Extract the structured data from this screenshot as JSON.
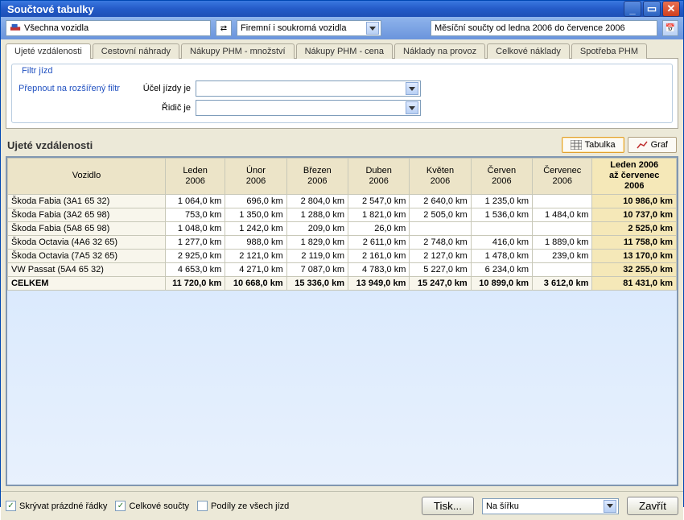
{
  "window": {
    "title": "Součtové tabulky"
  },
  "toolbar": {
    "vehicle": "Všechna vozidla",
    "ownership": "Firemní i soukromá vozidla",
    "period": "Měsíční součty od ledna 2006 do července 2006"
  },
  "tabs": [
    "Ujeté vzdálenosti",
    "Cestovní náhrady",
    "Nákupy PHM - množství",
    "Nákupy PHM - cena",
    "Náklady na provoz",
    "Celkové náklady",
    "Spotřeba PHM"
  ],
  "filter": {
    "legend": "Filtr jízd",
    "link": "Přepnout na rozšířený filtr",
    "purpose_lbl": "Účel jízdy je",
    "driver_lbl": "Řidič je"
  },
  "section": {
    "title": "Ujeté vzdálenosti",
    "tablabel": "Tabulka",
    "graflabel": "Graf"
  },
  "grid": {
    "col_vehicle": "Vozidlo",
    "months": [
      "Leden 2006",
      "Únor 2006",
      "Březen 2006",
      "Duben 2006",
      "Květen 2006",
      "Červen 2006",
      "Červenec 2006"
    ],
    "col_total": "Leden 2006 až červenec 2006",
    "rows": [
      {
        "name": "Škoda Fabia (3A1 65 32)",
        "v": [
          "1 064,0 km",
          "696,0 km",
          "2 804,0 km",
          "2 547,0 km",
          "2 640,0 km",
          "1 235,0 km",
          ""
        ],
        "t": "10 986,0 km"
      },
      {
        "name": "Škoda Fabia (3A2 65 98)",
        "v": [
          "753,0 km",
          "1 350,0 km",
          "1 288,0 km",
          "1 821,0 km",
          "2 505,0 km",
          "1 536,0 km",
          "1 484,0 km"
        ],
        "t": "10 737,0 km"
      },
      {
        "name": "Škoda Fabia (5A8 65 98)",
        "v": [
          "1 048,0 km",
          "1 242,0 km",
          "209,0 km",
          "26,0 km",
          "",
          "",
          ""
        ],
        "t": "2 525,0 km"
      },
      {
        "name": "Škoda Octavia (4A6 32 65)",
        "v": [
          "1 277,0 km",
          "988,0 km",
          "1 829,0 km",
          "2 611,0 km",
          "2 748,0 km",
          "416,0 km",
          "1 889,0 km"
        ],
        "t": "11 758,0 km"
      },
      {
        "name": "Škoda Octavia (7A5 32 65)",
        "v": [
          "2 925,0 km",
          "2 121,0 km",
          "2 119,0 km",
          "2 161,0 km",
          "2 127,0 km",
          "1 478,0 km",
          "239,0 km"
        ],
        "t": "13 170,0 km"
      },
      {
        "name": "VW Passat (5A4 65 32)",
        "v": [
          "4 653,0 km",
          "4 271,0 km",
          "7 087,0 km",
          "4 783,0 km",
          "5 227,0 km",
          "6 234,0 km",
          ""
        ],
        "t": "32 255,0 km"
      }
    ],
    "totalrow": {
      "name": "CELKEM",
      "v": [
        "11 720,0 km",
        "10 668,0 km",
        "15 336,0 km",
        "13 949,0 km",
        "15 247,0 km",
        "10 899,0 km",
        "3 612,0 km"
      ],
      "t": "81 431,0 km"
    }
  },
  "footer": {
    "hide_empty": "Skrývat prázdné řádky",
    "totals": "Celkové součty",
    "shares": "Podíly ze všech jízd",
    "print": "Tisk...",
    "orientation": "Na šířku",
    "close": "Zavřít"
  }
}
